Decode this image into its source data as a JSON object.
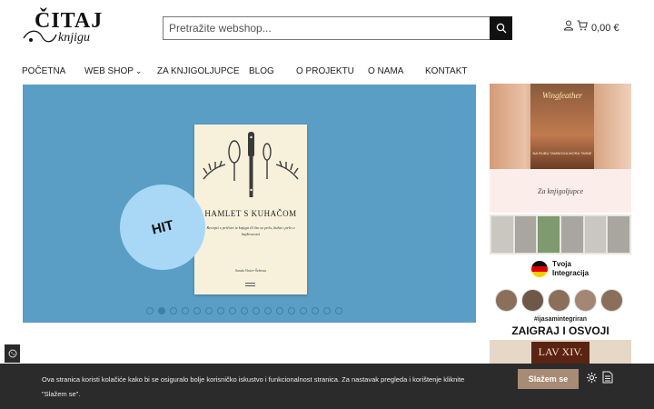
{
  "logo": {
    "line1": "ČITAJ",
    "line2": "knjigu"
  },
  "search": {
    "placeholder": "Pretražite webshop...",
    "value": ""
  },
  "header": {
    "cart_total": "0,00 €"
  },
  "nav": {
    "items": [
      {
        "label": "Početna"
      },
      {
        "label": "Web shop",
        "has_dropdown": true,
        "chevron": "⌄"
      },
      {
        "label": "Za knjigoljupce"
      },
      {
        "label": "Blog"
      },
      {
        "label": "O projektu"
      },
      {
        "label": "O nama"
      },
      {
        "label": "Kontakt"
      }
    ]
  },
  "hero": {
    "badge": "HIT",
    "book_title": "HAMLET S KUHAČOM",
    "book_subtitle": "Recepti s pričom iz knjiga ili što se pelo, kuha i pelo u knjževnosti",
    "book_author": "Sanda Vinter-Šebesta",
    "slide_count": 17,
    "active_slide": 2,
    "background_color": "#5a9ec5",
    "badge_color": "#a8d8f5"
  },
  "sidebar_banners": {
    "banner1": {
      "cover_title": "Wingfeather",
      "cover_sub": "NA RUBU TAMNOGA MORA TMINE",
      "caption": "Za knjigoljupce"
    },
    "banner3": {
      "title_line1": "Tvoja",
      "title_line2": "Integracija",
      "hashtag": "#ijasamintegriran",
      "headline": "ZAIGRAJ I OSVOJI"
    },
    "banner4": {
      "cover_title": "LAV XIV."
    }
  },
  "cookie_bar": {
    "text": "Ova stranica koristi kolačiće kako bi se osiguralo bolje korisničko iskustvo i funkcionalnost stranica. Za nastavak pregleda i korištenje kliknite \"Slažem se\".",
    "accept_label": "Slažem se",
    "accent_color": "#a78b74"
  }
}
